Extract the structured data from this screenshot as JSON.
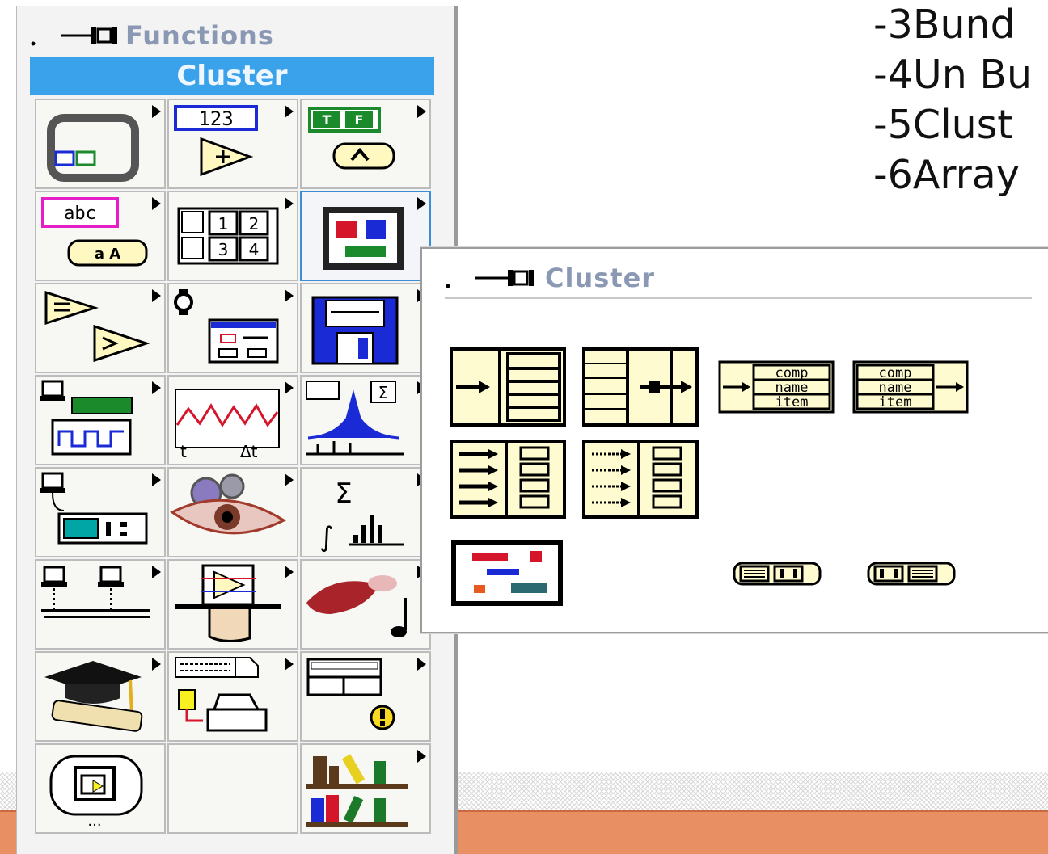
{
  "slide": {
    "lines": [
      "-3Bund",
      "-4Un Bu",
      "-5Clust",
      "-6Array"
    ]
  },
  "functions_palette": {
    "title": "Functions",
    "subpalette_label": "Cluster",
    "items": [
      {
        "icon": "structures-icon"
      },
      {
        "icon": "numeric-icon",
        "text": "123"
      },
      {
        "icon": "boolean-icon",
        "text": "TF"
      },
      {
        "icon": "string-icon",
        "text": "abc"
      },
      {
        "icon": "array-icon",
        "text": "12 34"
      },
      {
        "icon": "cluster-icon"
      },
      {
        "icon": "comparison-icon"
      },
      {
        "icon": "time-dialog-icon"
      },
      {
        "icon": "file-io-icon"
      },
      {
        "icon": "data-acquisition-icon"
      },
      {
        "icon": "waveform-icon"
      },
      {
        "icon": "analyze-icon"
      },
      {
        "icon": "instrument-io-icon"
      },
      {
        "icon": "motion-vision-icon"
      },
      {
        "icon": "mathematics-icon"
      },
      {
        "icon": "communication-icon"
      },
      {
        "icon": "application-control-icon"
      },
      {
        "icon": "graphics-sound-icon"
      },
      {
        "icon": "tutorial-icon"
      },
      {
        "icon": "report-generation-icon"
      },
      {
        "icon": "advanced-icon"
      },
      {
        "icon": "select-vi-icon"
      },
      {
        "icon": "user-libraries-icon"
      }
    ]
  },
  "cluster_palette": {
    "title": "Cluster",
    "tools": [
      {
        "icon": "unbundle-icon"
      },
      {
        "icon": "bundle-icon"
      },
      {
        "icon": "bundle-by-name-icon",
        "labels": [
          "comp",
          "name",
          "item"
        ]
      },
      {
        "icon": "unbundle-by-name-icon",
        "labels": [
          "comp",
          "name",
          "item"
        ]
      },
      {
        "icon": "build-cluster-array-icon"
      },
      {
        "icon": "index-bundle-cluster-array-icon"
      },
      {
        "icon": "cluster-constant-icon"
      },
      {
        "icon": "cluster-to-array-icon"
      },
      {
        "icon": "array-to-cluster-icon"
      }
    ]
  }
}
